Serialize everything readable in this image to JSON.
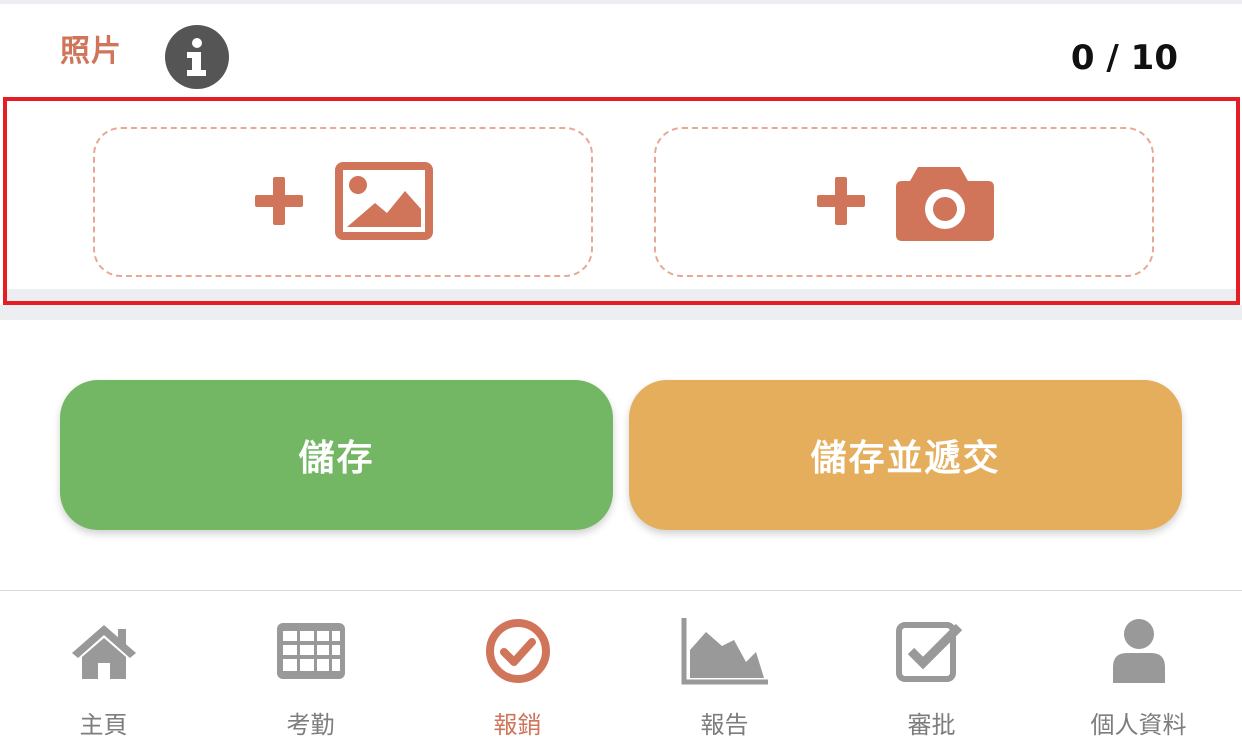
{
  "photo_section": {
    "title": "照片",
    "counter": "0 / 10"
  },
  "upload": {
    "gallery_icon": "add-image-icon",
    "camera_icon": "add-camera-icon"
  },
  "actions": {
    "save_label": "儲存",
    "submit_label": "儲存並遞交"
  },
  "tabbar": {
    "active": "報銷",
    "items": [
      {
        "label": "主頁",
        "icon": "home-icon"
      },
      {
        "label": "考勤",
        "icon": "calendar-grid-icon"
      },
      {
        "label": "報銷",
        "icon": "check-circle-icon"
      },
      {
        "label": "報告",
        "icon": "area-chart-icon"
      },
      {
        "label": "審批",
        "icon": "checkbox-icon"
      },
      {
        "label": "個人資料",
        "icon": "user-icon"
      }
    ]
  },
  "colors": {
    "accent": "#d0745a",
    "save": "#73b765",
    "submit": "#e5ae5d",
    "highlight_border": "#e41e24",
    "inactive_icon": "#999999",
    "dashed_border": "#e8a994"
  }
}
